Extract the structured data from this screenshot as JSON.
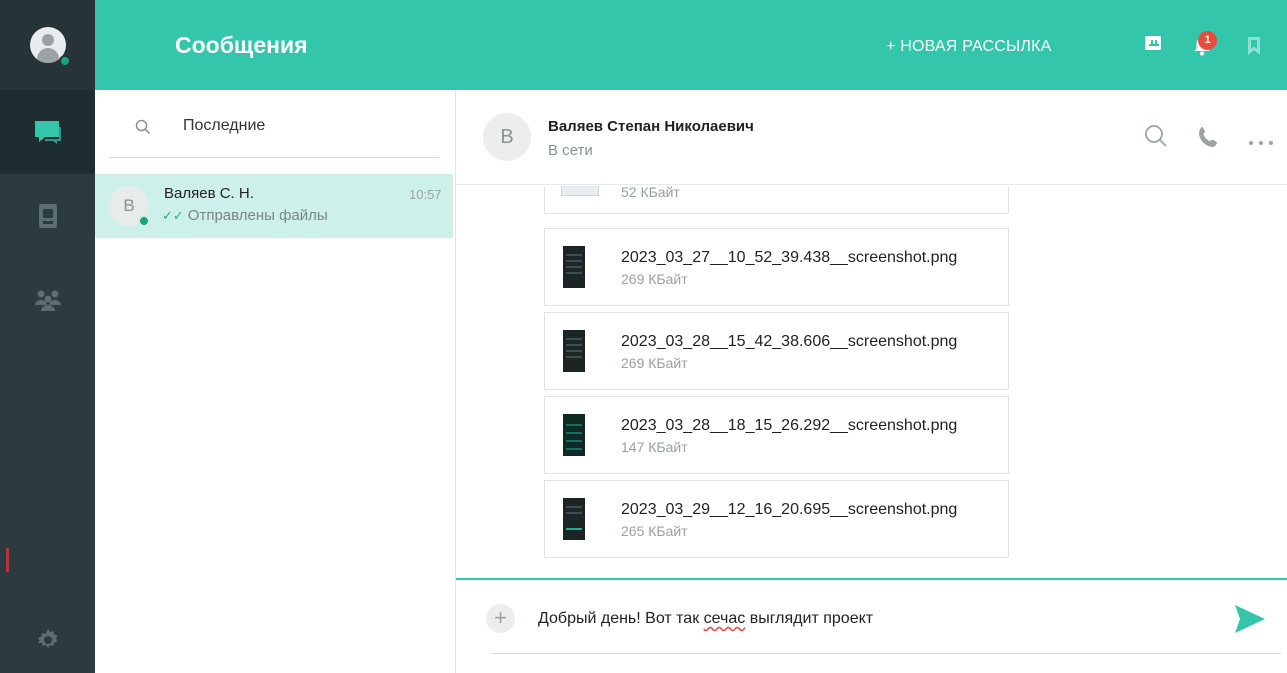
{
  "colors": {
    "accent": "#34c6ab",
    "rail": "#2b3b40",
    "online": "#1ea07a",
    "badge": "#e74c3c",
    "selected_row": "#cdf1ea"
  },
  "header": {
    "title": "Сообщения",
    "new_broadcast": "+ НОВАЯ РАССЫЛКА",
    "notifications_count": "1",
    "icons": [
      "contacts-book-icon",
      "bell-icon",
      "bookmark-icon"
    ]
  },
  "rail": {
    "icons": [
      "user-avatar",
      "messages-icon",
      "contacts-icon",
      "groups-icon",
      "settings-icon"
    ]
  },
  "list": {
    "search_label": "Последние",
    "chats": [
      {
        "initial": "В",
        "name": "Валяев С. Н.",
        "time": "10:57",
        "preview": "Отправлены файлы",
        "ticks": "✓✓"
      }
    ]
  },
  "conversation": {
    "initial": "В",
    "name": "Валяев Степан Николаевич",
    "status": "В сети",
    "icons": [
      "search-icon",
      "phone-icon",
      "more-icon"
    ],
    "files": [
      {
        "name": "",
        "size": "52 КБайт"
      },
      {
        "name": "2023_03_27__10_52_39.438__screenshot.png",
        "size": "269 КБайт"
      },
      {
        "name": "2023_03_28__15_42_38.606__screenshot.png",
        "size": "269 КБайт"
      },
      {
        "name": "2023_03_28__18_15_26.292__screenshot.png",
        "size": "147 КБайт"
      },
      {
        "name": "2023_03_29__12_16_20.695__screenshot.png",
        "size": "265 КБайт"
      }
    ]
  },
  "composer": {
    "text_before": "Добрый день! Вот так ",
    "text_misspelled": "сечас",
    "text_after": " выглядит проект",
    "plus": "+"
  }
}
